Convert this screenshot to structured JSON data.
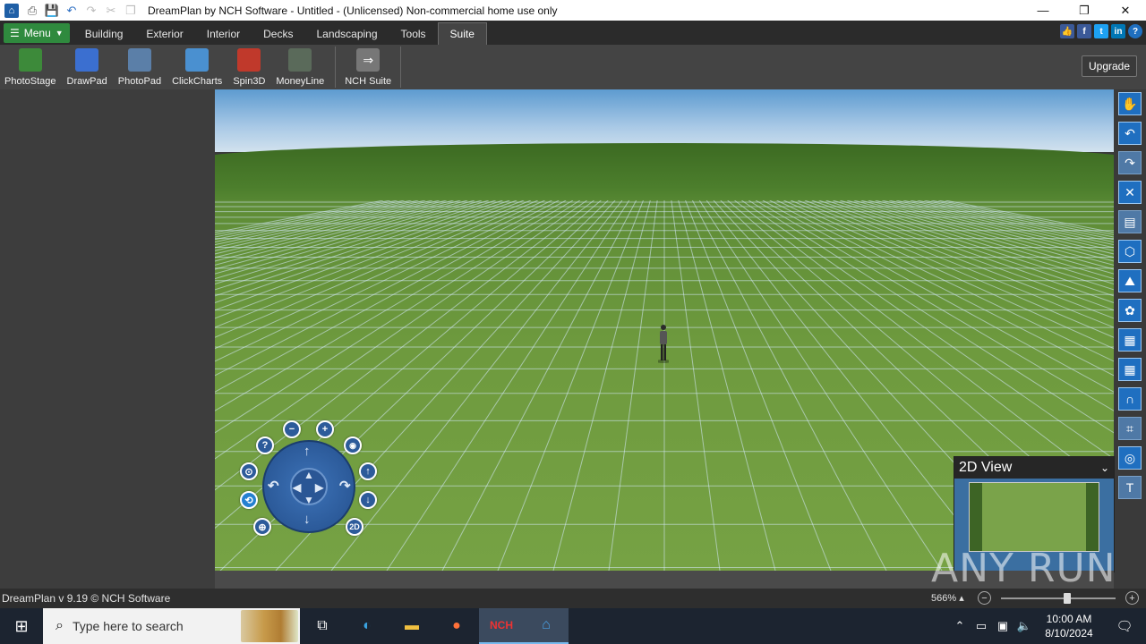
{
  "titlebar": {
    "title": "DreamPlan by NCH Software - Untitled - (Unlicensed) Non-commercial home use only",
    "quick_access": [
      "print-icon",
      "save-icon",
      "undo-icon",
      "redo-icon",
      "cut-icon",
      "copy-icon"
    ],
    "controls": {
      "minimize": "—",
      "maximize": "❐",
      "close": "✕"
    }
  },
  "ribbon": {
    "menu_label": "Menu",
    "tabs": [
      {
        "label": "Building",
        "active": false
      },
      {
        "label": "Exterior",
        "active": false
      },
      {
        "label": "Interior",
        "active": false
      },
      {
        "label": "Decks",
        "active": false
      },
      {
        "label": "Landscaping",
        "active": false
      },
      {
        "label": "Tools",
        "active": false
      },
      {
        "label": "Suite",
        "active": true
      }
    ],
    "social": [
      "like-icon",
      "facebook-icon",
      "twitter-icon",
      "linkedin-icon",
      "help-icon"
    ]
  },
  "toolbar": {
    "items": [
      {
        "label": "PhotoStage",
        "icon": "photostage-icon",
        "color": "#3d8a3a"
      },
      {
        "label": "DrawPad",
        "icon": "drawpad-icon",
        "color": "#3b6fd0"
      },
      {
        "label": "PhotoPad",
        "icon": "photopad-icon",
        "color": "#5b7fa8"
      },
      {
        "label": "ClickCharts",
        "icon": "clickcharts-icon",
        "color": "#4a90d0"
      },
      {
        "label": "Spin3D",
        "icon": "spin3d-icon",
        "color": "#c0392b"
      },
      {
        "label": "MoneyLine",
        "icon": "moneyline-icon",
        "color": "#5a6a5a"
      }
    ],
    "suite": {
      "label": "NCH Suite",
      "icon": "nch-suite-icon",
      "color": "#777777"
    },
    "upgrade_label": "Upgrade"
  },
  "right_tools": [
    {
      "name": "hand-icon",
      "glyph": "✋",
      "dim": false
    },
    {
      "name": "undo-icon",
      "glyph": "↶",
      "dim": false
    },
    {
      "name": "redo-icon",
      "glyph": "↷",
      "dim": true
    },
    {
      "name": "delete-icon",
      "glyph": "✕",
      "dim": false
    },
    {
      "name": "properties-icon",
      "glyph": "▤",
      "dim": true
    },
    {
      "name": "box-3d-icon",
      "glyph": "⬡",
      "dim": false
    },
    {
      "name": "terrain-icon",
      "glyph": "⛰",
      "dim": false
    },
    {
      "name": "materials-icon",
      "glyph": "✿",
      "dim": false
    },
    {
      "name": "layers-icon",
      "glyph": "▦",
      "dim": false
    },
    {
      "name": "grid-icon",
      "glyph": "▦",
      "dim": false
    },
    {
      "name": "magnet-icon",
      "glyph": "∩",
      "dim": false
    },
    {
      "name": "crop-icon",
      "glyph": "⌗",
      "dim": true
    },
    {
      "name": "compass-icon",
      "glyph": "◎",
      "dim": false
    },
    {
      "name": "text-icon",
      "glyph": "T",
      "dim": true
    }
  ],
  "nav": {
    "zoom_out": "−",
    "zoom_in": "+",
    "help": "?",
    "camera": "📷",
    "twod": "2D"
  },
  "view2d": {
    "title": "2D View"
  },
  "status": {
    "text": "DreamPlan v 9.19 © NCH Software",
    "zoom": "566%",
    "zoom_level": 0.58
  },
  "watermark": "ANY RUN",
  "taskbar": {
    "search_placeholder": "Type here to search",
    "time": "10:00 AM",
    "date": "8/10/2024",
    "apps": [
      "task-view-icon",
      "edge-icon",
      "file-explorer-icon",
      "firefox-icon",
      "nch-icon",
      "dreamplan-icon"
    ]
  }
}
